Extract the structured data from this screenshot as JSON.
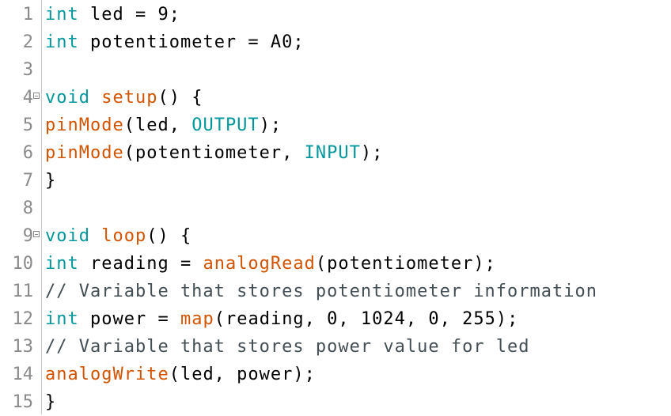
{
  "editor": {
    "lines": [
      {
        "number": "1",
        "fold": false,
        "tokens": [
          {
            "t": "int",
            "c": "kw"
          },
          {
            "t": " led = 9;",
            "c": "pl"
          }
        ]
      },
      {
        "number": "2",
        "fold": false,
        "tokens": [
          {
            "t": "int",
            "c": "kw"
          },
          {
            "t": " potentiometer = A0;",
            "c": "pl"
          }
        ]
      },
      {
        "number": "3",
        "fold": false,
        "tokens": []
      },
      {
        "number": "4",
        "fold": true,
        "tokens": [
          {
            "t": "void",
            "c": "kw"
          },
          {
            "t": " ",
            "c": "pl"
          },
          {
            "t": "setup",
            "c": "fn"
          },
          {
            "t": "() {",
            "c": "pl"
          }
        ]
      },
      {
        "number": "5",
        "fold": false,
        "tokens": [
          {
            "t": "pinMode",
            "c": "fn"
          },
          {
            "t": "(led, ",
            "c": "pl"
          },
          {
            "t": "OUTPUT",
            "c": "kw"
          },
          {
            "t": ");",
            "c": "pl"
          }
        ]
      },
      {
        "number": "6",
        "fold": false,
        "tokens": [
          {
            "t": "pinMode",
            "c": "fn"
          },
          {
            "t": "(potentiometer, ",
            "c": "pl"
          },
          {
            "t": "INPUT",
            "c": "kw"
          },
          {
            "t": ");",
            "c": "pl"
          }
        ]
      },
      {
        "number": "7",
        "fold": false,
        "tokens": [
          {
            "t": "}",
            "c": "pl"
          }
        ]
      },
      {
        "number": "8",
        "fold": false,
        "tokens": []
      },
      {
        "number": "9",
        "fold": true,
        "tokens": [
          {
            "t": "void",
            "c": "kw"
          },
          {
            "t": " ",
            "c": "pl"
          },
          {
            "t": "loop",
            "c": "fn"
          },
          {
            "t": "() {",
            "c": "pl"
          }
        ]
      },
      {
        "number": "10",
        "fold": false,
        "tokens": [
          {
            "t": "int",
            "c": "kw"
          },
          {
            "t": " reading = ",
            "c": "pl"
          },
          {
            "t": "analogRead",
            "c": "fn"
          },
          {
            "t": "(potentiometer);",
            "c": "pl"
          }
        ]
      },
      {
        "number": "11",
        "fold": false,
        "tokens": [
          {
            "t": "// Variable that stores potentiometer information",
            "c": "cm"
          }
        ]
      },
      {
        "number": "12",
        "fold": false,
        "tokens": [
          {
            "t": "int",
            "c": "kw"
          },
          {
            "t": " power = ",
            "c": "pl"
          },
          {
            "t": "map",
            "c": "fn"
          },
          {
            "t": "(reading, 0, 1024, 0, 255);",
            "c": "pl"
          }
        ]
      },
      {
        "number": "13",
        "fold": false,
        "tokens": [
          {
            "t": "// Variable that stores power value for led",
            "c": "cm"
          }
        ]
      },
      {
        "number": "14",
        "fold": false,
        "tokens": [
          {
            "t": "analogWrite",
            "c": "fn"
          },
          {
            "t": "(led, power);",
            "c": "pl"
          }
        ]
      },
      {
        "number": "15",
        "fold": false,
        "tokens": [
          {
            "t": "}",
            "c": "pl"
          }
        ]
      }
    ]
  },
  "colors": {
    "keyword": "#00979c",
    "function": "#d35400",
    "comment": "#434f54",
    "line_number": "#8a8a8a"
  },
  "icons": {
    "fold": "fold-collapse-icon"
  }
}
